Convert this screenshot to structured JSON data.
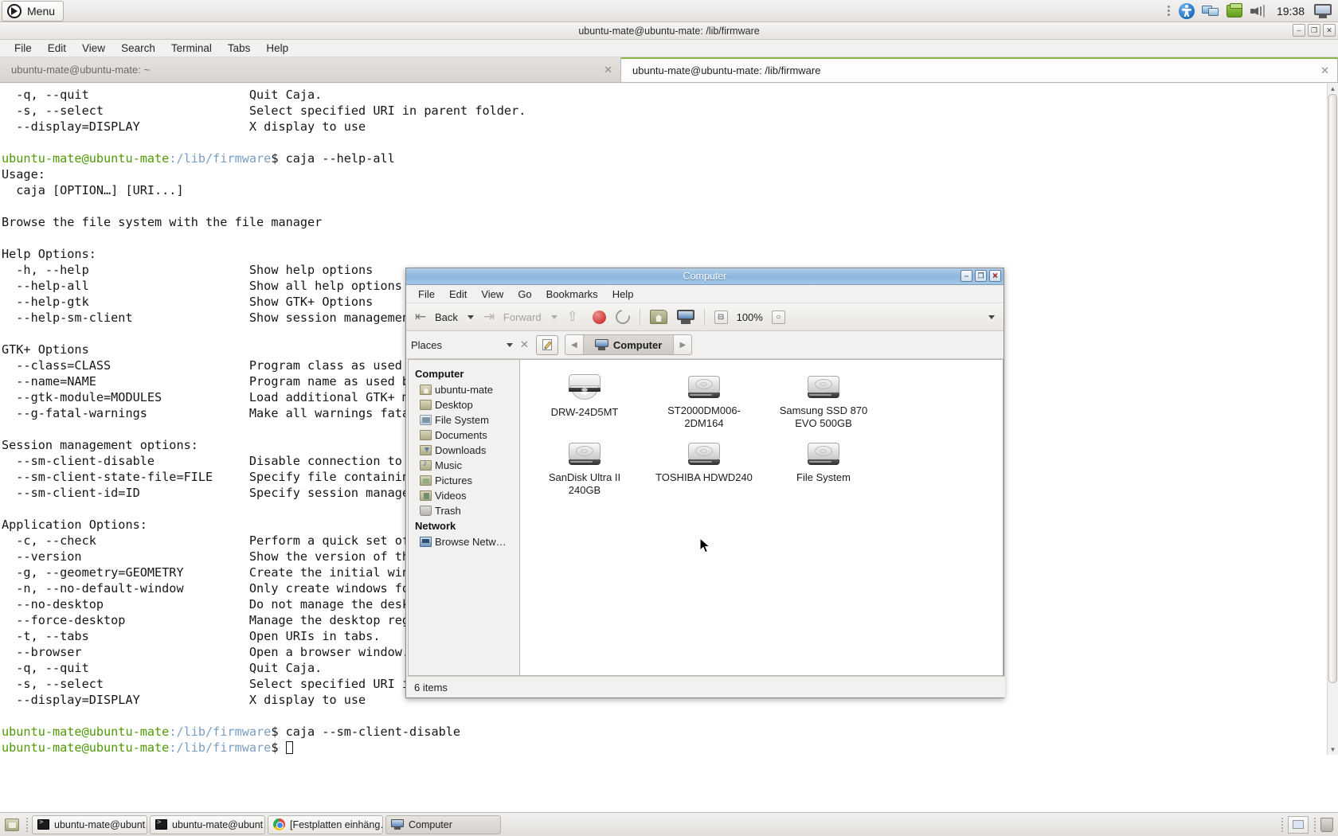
{
  "panel": {
    "menu_label": "Menu",
    "clock": "19:38",
    "tray_icons": [
      "accessibility-icon",
      "network-display-icon",
      "software-updates-icon",
      "volume-icon",
      "display-icon"
    ]
  },
  "terminal": {
    "title": "ubuntu-mate@ubuntu-mate: /lib/firmware",
    "menus": [
      "File",
      "Edit",
      "View",
      "Search",
      "Terminal",
      "Tabs",
      "Help"
    ],
    "tabs": [
      {
        "label": "ubuntu-mate@ubuntu-mate: ~",
        "close": "✕",
        "active": false
      },
      {
        "label": "ubuntu-mate@ubuntu-mate: /lib/firmware",
        "close": "✕",
        "active": true
      }
    ],
    "win_buttons": [
      "–",
      "❐",
      "✕"
    ],
    "lines": [
      "  -q, --quit                      Quit Caja.",
      "  -s, --select                    Select specified URI in parent folder.",
      "  --display=DISPLAY               X display to use",
      "",
      "PROMPT1",
      "Usage:",
      "  caja [OPTION…] [URI...]",
      "",
      "Browse the file system with the file manager",
      "",
      "Help Options:",
      "  -h, --help                      Show help options",
      "  --help-all                      Show all help options",
      "  --help-gtk                      Show GTK+ Options",
      "  --help-sm-client                Show session management options",
      "",
      "GTK+ Options",
      "  --class=CLASS                   Program class as used by the window manager",
      "  --name=NAME                     Program name as used by the window manager",
      "  --gtk-module=MODULES            Load additional GTK+ modules",
      "  --g-fatal-warnings              Make all warnings fatal",
      "",
      "Session management options:",
      "  --sm-client-disable             Disable connection to session manager",
      "  --sm-client-state-file=FILE     Specify file containing saved configuration",
      "  --sm-client-id=ID               Specify session management ID",
      "",
      "Application Options:",
      "  -c, --check                     Perform a quick set of self-check tests.",
      "  --version                       Show the version of the program.",
      "  -g, --geometry=GEOMETRY         Create the initial window with the given geometry.",
      "  -n, --no-default-window         Only create windows for explicitly specified URIs.",
      "  --no-desktop                    Do not manage the desktop (ignore the preference",
      "  --force-desktop                 Manage the desktop regardless of set preferences",
      "  -t, --tabs                      Open URIs in tabs.",
      "  --browser                       Open a browser window.",
      "  -q, --quit                      Quit Caja.",
      "  -s, --select                    Select specified URI in parent folder.",
      "  --display=DISPLAY               X display to use",
      "",
      "PROMPT2",
      "PROMPT3"
    ],
    "prompt_user": "ubuntu-mate@ubuntu-mate",
    "prompt_path": ":/lib/firmware",
    "prompt_sigil": "$ ",
    "command1": "caja --help-all",
    "command2": "caja --sm-client-disable",
    "command3": ""
  },
  "caja": {
    "title": "Computer",
    "win_buttons": [
      "–",
      "❐",
      "✕"
    ],
    "menus": [
      "File",
      "Edit",
      "View",
      "Go",
      "Bookmarks",
      "Help"
    ],
    "toolbar": {
      "back_label": "Back",
      "forward_label": "Forward",
      "zoom_level": "100%",
      "icons": [
        "back-icon",
        "forward-icon",
        "up-icon",
        "stop-icon",
        "reload-icon",
        "home-icon",
        "computer-icon",
        "zoom-out-icon",
        "zoom-reset-icon"
      ]
    },
    "location": {
      "places_label": "Places",
      "close_label": "✕",
      "edit_location_icon": "edit-location-icon",
      "breadcrumb": "Computer"
    },
    "sidebar": {
      "sections": [
        {
          "header": "Computer",
          "items": [
            {
              "label": "ubuntu-mate",
              "icon": "home-folder-icon"
            },
            {
              "label": "Desktop",
              "icon": "desktop-folder-icon"
            },
            {
              "label": "File System",
              "icon": "filesystem-icon"
            },
            {
              "label": "Documents",
              "icon": "documents-folder-icon"
            },
            {
              "label": "Downloads",
              "icon": "downloads-folder-icon"
            },
            {
              "label": "Music",
              "icon": "music-folder-icon"
            },
            {
              "label": "Pictures",
              "icon": "pictures-folder-icon"
            },
            {
              "label": "Videos",
              "icon": "videos-folder-icon"
            },
            {
              "label": "Trash",
              "icon": "trash-icon"
            }
          ]
        },
        {
          "header": "Network",
          "items": [
            {
              "label": "Browse Netw…",
              "icon": "network-icon"
            }
          ]
        }
      ]
    },
    "devices": [
      {
        "label": "DRW-24D5MT",
        "icon": "optical-drive-icon"
      },
      {
        "label": "ST2000DM006-2DM164",
        "icon": "hard-drive-icon"
      },
      {
        "label": "Samsung SSD 870 EVO 500GB",
        "icon": "hard-drive-icon"
      },
      {
        "label": "SanDisk Ultra II 240GB",
        "icon": "hard-drive-icon"
      },
      {
        "label": "TOSHIBA HDWD240",
        "icon": "hard-drive-icon"
      },
      {
        "label": "File System",
        "icon": "hard-drive-icon"
      }
    ],
    "status": "6 items"
  },
  "taskbar": {
    "show_desktop_icon": "show-desktop-icon",
    "tasks": [
      {
        "label": "ubuntu-mate@ubunt…",
        "icon": "terminal-icon",
        "active": false
      },
      {
        "label": "ubuntu-mate@ubunt…",
        "icon": "terminal-icon",
        "active": false
      },
      {
        "label": "[Festplatten einhäng…",
        "icon": "chrome-icon",
        "active": false
      },
      {
        "label": "Computer",
        "icon": "computer-icon",
        "active": true
      }
    ],
    "workspace_icon": "workspace-switcher-icon",
    "trash_icon": "trash-icon"
  },
  "colors": {
    "panel_bg": "#f2f1f0",
    "terminal_green": "#4e9a06",
    "terminal_blue": "#7a9ec2",
    "caja_title": "#8cb6dd",
    "tab_accent": "#8ab44a"
  }
}
